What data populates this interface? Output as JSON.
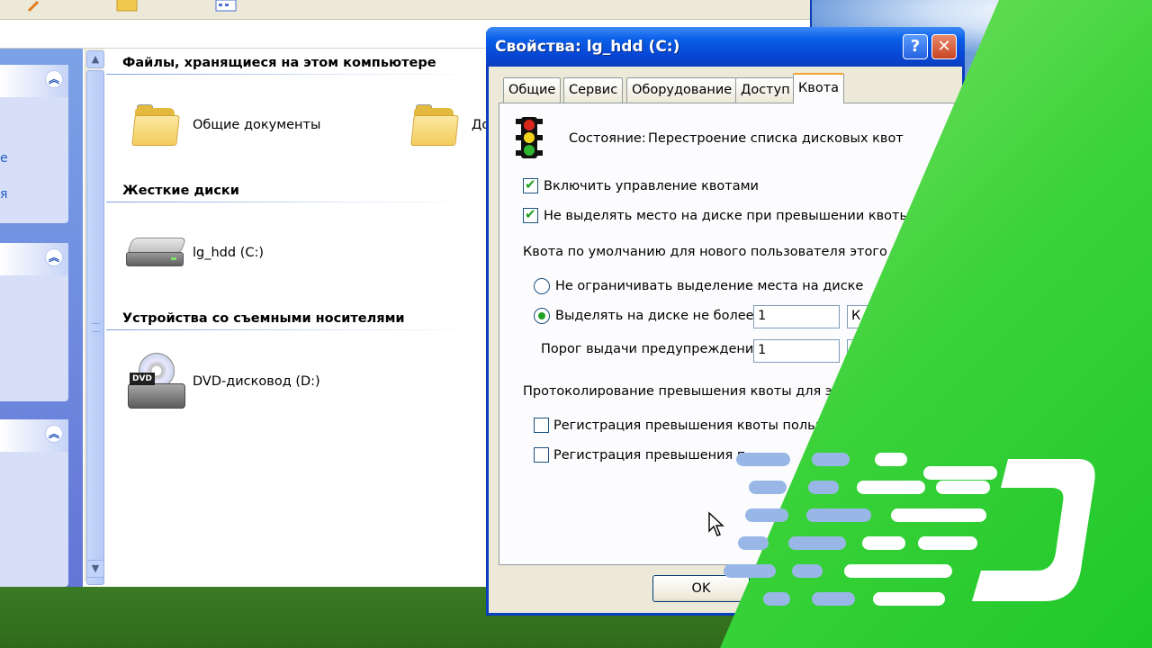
{
  "explorer": {
    "group_files": "Файлы, хранящиеся на этом компьютере",
    "item_shared_docs": "Общие документы",
    "item_second_folder_partial": "До",
    "group_hdd": "Жесткие диски",
    "item_c_drive": "lg_hdd (C:)",
    "group_removable": "Устройства со съемными носителями",
    "item_dvd": "DVD-дисковод (D:)",
    "task_stub_1": "е",
    "task_stub_2": "я"
  },
  "dialog": {
    "title": "Свойства: lg_hdd (C:)",
    "help_label": "?",
    "close_label": "✕",
    "tabs": [
      {
        "label": "Общие"
      },
      {
        "label": "Сервис"
      },
      {
        "label": "Оборудование"
      },
      {
        "label": "Доступ"
      },
      {
        "label": "Квота"
      }
    ],
    "active_tab": "Квота",
    "status_label": "Состояние:",
    "status_value": "Перестроение списка дисковых квот",
    "cb_enable_quota": {
      "label": "Включить управление квотами",
      "checked": true
    },
    "cb_deny_space": {
      "label": "Не выделять место на диске при превышении квоты",
      "checked": true
    },
    "default_quota_label": "Квота по умолчанию для нового пользователя этого то",
    "radio_no_limit": {
      "label": "Не ограничивать выделение места на диске",
      "selected": false
    },
    "radio_limit": {
      "label": "Выделять на диске не более",
      "selected": true
    },
    "limit_value": "1",
    "limit_units_partial": "К",
    "warning_label": "Порог выдачи предупреждений",
    "warning_value": "1",
    "logging_label": "Протоколирование превышения квоты для это",
    "cb_log_quota": {
      "label": "Регистрация превышения квоты польз",
      "checked": false
    },
    "cb_log_warning": {
      "label": "Регистрация превышения п",
      "checked": false
    },
    "ok_label": "OK"
  },
  "colors": {
    "xp_title_blue": "#0a5fe8",
    "dialog_face": "#ece9d8",
    "check_green": "#21a121",
    "overlay_green": "#3bd23a",
    "logo_blue": "#98b7e6"
  },
  "icons": [
    "folder-icon",
    "hdd-icon",
    "dvd-icon",
    "traffic-light-icon",
    "mouse-cursor-icon",
    "d-logo"
  ]
}
